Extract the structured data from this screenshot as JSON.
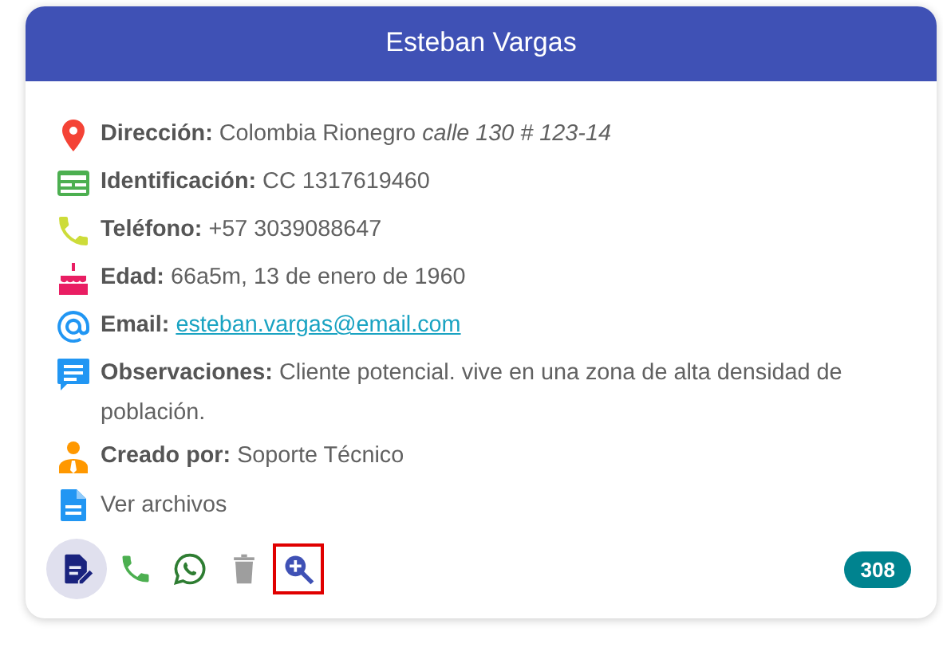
{
  "card": {
    "title": "Esteban Vargas",
    "fields": [
      {
        "kind": "address",
        "label": "Dirección:",
        "value": "Colombia Rionegro *calle 130 # 123-14*"
      },
      {
        "kind": "id",
        "label": "Identificación:",
        "value": "CC 1317619460"
      },
      {
        "kind": "phone",
        "label": "Teléfono:",
        "value": "+57 3039088647"
      },
      {
        "kind": "birthday",
        "label": "Edad:",
        "value": "66a5m, 13 de enero de 1960"
      },
      {
        "kind": "email",
        "label": "Email:",
        "link": "esteban.vargas@email.com"
      },
      {
        "kind": "notes",
        "label": "Observaciones:",
        "value": "Cliente potencial. vive en una zona de alta densidad de población."
      },
      {
        "kind": "creator",
        "label": "Creado por:",
        "value": "Soporte Técnico"
      },
      {
        "kind": "files",
        "link": "Ver archivos"
      }
    ],
    "actions": [
      {
        "kind": "edit",
        "selected": true,
        "focused": false
      },
      {
        "kind": "call",
        "selected": false,
        "focused": false
      },
      {
        "kind": "whatsapp",
        "selected": false,
        "focused": false
      },
      {
        "kind": "delete",
        "selected": false,
        "focused": false
      },
      {
        "kind": "zoom",
        "selected": false,
        "focused": true
      }
    ],
    "badge": "308"
  }
}
